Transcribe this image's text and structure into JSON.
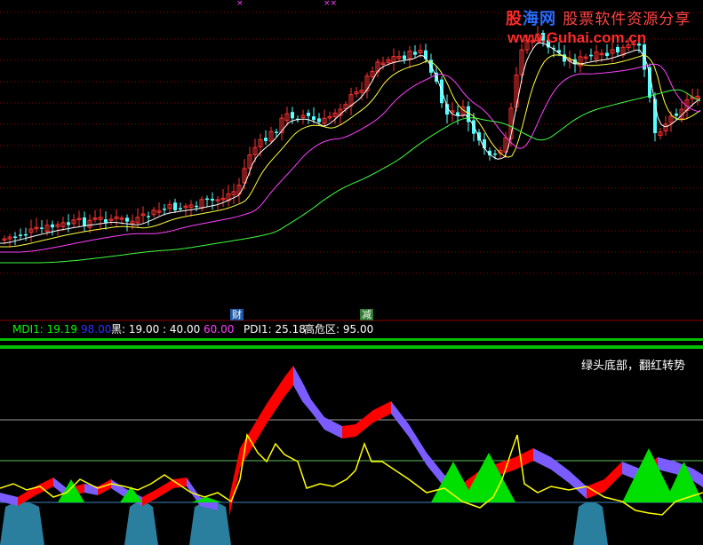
{
  "watermark": {
    "brand_red": "股",
    "brand_blue": "海网",
    "brand_sub": "股票软件资源分享",
    "url": "www.Guhai.com.cn"
  },
  "markers": [
    "×",
    "××"
  ],
  "badges": {
    "cai": "财",
    "jian": "减"
  },
  "indicator_header": {
    "mdi_label": "MDI1: 19.19",
    "mdi_extra": "98.00",
    "hei_label": "黑: 19.00 : 40.00",
    "level60": "60.00",
    "pdi_label": "PDI1: 25.18",
    "danger_label": "高危区: 95.00"
  },
  "annotation": "绿头底部，翻红转势",
  "colors": {
    "candle_up": "#ff3232",
    "candle_down": "#54ffff",
    "ma_white": "#ffffff",
    "ma_yellow": "#ffff40",
    "ma_magenta": "#ff40ff",
    "ma_green": "#40ff40",
    "grid_dotted": "#8b0000",
    "separator": "#00c000",
    "ind_red": "#ff0000",
    "ind_purple": "#7a5cff",
    "ind_green": "#00e000",
    "ind_blue": "#2a7e9e",
    "ind_yellow": "#ffff00",
    "mdi_color": "#00ff00",
    "mdi_extra_color": "#0000ff",
    "level60_color": "#ff00ff"
  }
}
